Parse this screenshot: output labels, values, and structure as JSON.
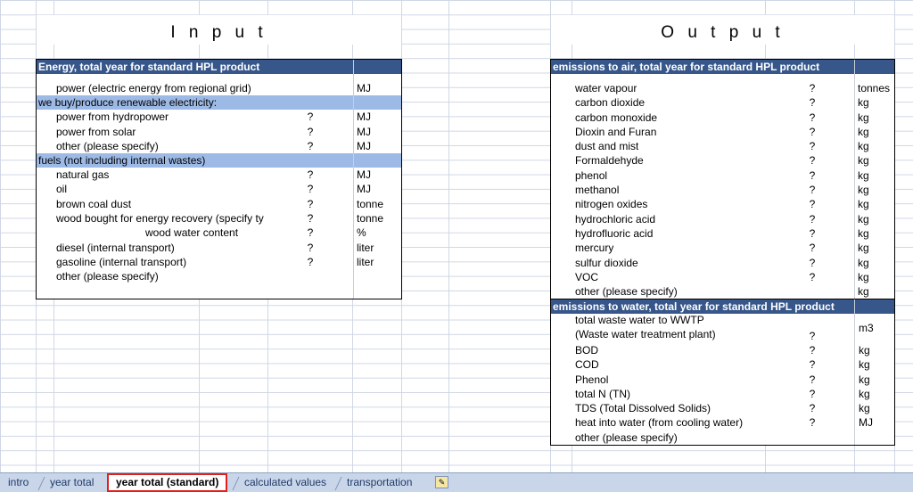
{
  "input": {
    "title": "I n p u t",
    "header": "Energy, total year for standard HPL product",
    "rows": [
      {
        "label": "power (electric energy from regional grid)",
        "q": "",
        "unit": "MJ",
        "indent": 22
      },
      {
        "sub": "we buy/produce renewable electricity:"
      },
      {
        "label": "power from hydropower",
        "q": "?",
        "unit": "MJ",
        "indent": 22
      },
      {
        "label": "power from solar",
        "q": "?",
        "unit": "MJ",
        "indent": 22
      },
      {
        "label": "other (please specify)",
        "q": "?",
        "unit": "MJ",
        "indent": 22
      },
      {
        "sub": "fuels (not including internal wastes)"
      },
      {
        "label": "natural gas",
        "q": "?",
        "unit": "MJ",
        "indent": 22
      },
      {
        "label": "oil",
        "q": "?",
        "unit": "MJ",
        "indent": 22
      },
      {
        "label": "brown coal dust",
        "q": "?",
        "unit": "tonne",
        "indent": 22
      },
      {
        "label": "wood bought for energy recovery (specify ty",
        "q": "?",
        "unit": "tonne",
        "indent": 22
      },
      {
        "label": "wood water content",
        "q": "?",
        "unit": "%",
        "indent": 122
      },
      {
        "label": "diesel (internal transport)",
        "q": "?",
        "unit": "liter",
        "indent": 22
      },
      {
        "label": "gasoline (internal transport)",
        "q": "?",
        "unit": "liter",
        "indent": 22
      },
      {
        "label": "other (please specify)",
        "q": "",
        "unit": "",
        "indent": 22
      }
    ]
  },
  "output": {
    "title": "O u t p u t",
    "air_header": "emissions to air, total year for standard HPL product",
    "air_rows": [
      {
        "label": "water vapour",
        "q": "?",
        "unit": "tonnes"
      },
      {
        "label": "carbon dioxide",
        "q": "?",
        "unit": "kg"
      },
      {
        "label": "carbon monoxide",
        "q": "?",
        "unit": "kg"
      },
      {
        "label": "Dioxin and Furan",
        "q": "?",
        "unit": "kg"
      },
      {
        "label": "dust and mist",
        "q": "?",
        "unit": "kg"
      },
      {
        "label": "Formaldehyde",
        "q": "?",
        "unit": "kg"
      },
      {
        "label": "phenol",
        "q": "?",
        "unit": "kg"
      },
      {
        "label": "methanol",
        "q": "?",
        "unit": "kg"
      },
      {
        "label": "nitrogen oxides",
        "q": "?",
        "unit": "kg"
      },
      {
        "label": "hydrochloric acid",
        "q": "?",
        "unit": "kg"
      },
      {
        "label": "hydrofluoric acid",
        "q": "?",
        "unit": "kg"
      },
      {
        "label": "mercury",
        "q": "?",
        "unit": "kg"
      },
      {
        "label": "sulfur dioxide",
        "q": "?",
        "unit": "kg"
      },
      {
        "label": "VOC",
        "q": "?",
        "unit": "kg"
      },
      {
        "label": "other (please specify)",
        "q": "",
        "unit": "kg"
      }
    ],
    "water_header": "emissions to water, total year for standard HPL product",
    "water_first": {
      "line1": "total waste water to WWTP",
      "line2": "(Waste water treatment plant)",
      "q": "?",
      "unit": "m3"
    },
    "water_rows": [
      {
        "label": "BOD",
        "q": "?",
        "unit": "kg"
      },
      {
        "label": "COD",
        "q": "?",
        "unit": "kg"
      },
      {
        "label": "Phenol",
        "q": "?",
        "unit": "kg"
      },
      {
        "label": "total N (TN)",
        "q": "?",
        "unit": "kg"
      },
      {
        "label": "TDS (Total Dissolved Solids)",
        "q": "?",
        "unit": "kg"
      },
      {
        "label": "heat into water (from cooling water)",
        "q": "?",
        "unit": "MJ"
      },
      {
        "label": "other (please specify)",
        "q": "",
        "unit": ""
      }
    ]
  },
  "tabs": {
    "items": [
      "intro",
      "year total",
      "year total (standard)",
      "calculated values",
      "transportation"
    ],
    "active": "year total (standard)",
    "new_sheet_icon": "insert-sheet-icon"
  }
}
